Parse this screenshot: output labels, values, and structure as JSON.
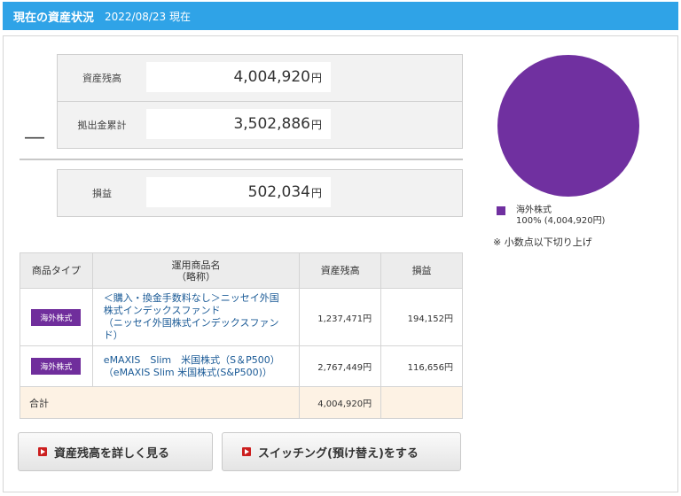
{
  "header": {
    "title": "現在の資産状況",
    "date": "2022/08/23 現在"
  },
  "summary": {
    "balance": {
      "label": "資産残高",
      "value": "4,004,920",
      "unit": "円"
    },
    "contribution": {
      "label": "拠出金累計",
      "value": "3,502,886",
      "unit": "円"
    },
    "minus_symbol": "―",
    "gain": {
      "label": "損益",
      "value": "502,034",
      "unit": "円"
    }
  },
  "chart_data": {
    "type": "pie",
    "slices": [
      {
        "name": "海外株式",
        "value": 100,
        "color": "#7030a0"
      }
    ]
  },
  "legend": {
    "name": "海外株式",
    "pct": "100% (4,004,920円)",
    "color": "#7030a0"
  },
  "note": "※ 小数点以下切り上げ",
  "table": {
    "headers": {
      "type": "商品タイプ",
      "name": "運用商品名\n（略称）",
      "balance": "資産残高",
      "gain": "損益"
    },
    "rows": [
      {
        "type": "海外株式",
        "name": "＜購入・換金手数料なし＞ニッセイ外国株式インデックスファンド\n（ニッセイ外国株式インデックスファンド）",
        "balance": "1,237,471円",
        "gain": "194,152円"
      },
      {
        "type": "海外株式",
        "name": "eMAXIS　Slim　米国株式（S＆P500）\n（eMAXIS Slim 米国株式(S&P500)）",
        "balance": "2,767,449円",
        "gain": "116,656円"
      }
    ],
    "total": {
      "label": "合計",
      "balance": "4,004,920円",
      "gain": ""
    }
  },
  "buttons": {
    "detail": "資産残高を詳しく見る",
    "switching": "スイッチング(預け替え)をする"
  },
  "colors": {
    "header_bg": "#2fa3e7",
    "accent_purple": "#7030a0",
    "button_icon": "#cc1f1f"
  }
}
